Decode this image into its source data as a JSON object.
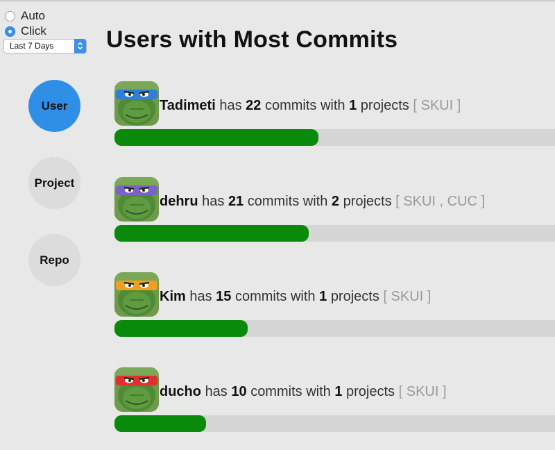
{
  "controls": {
    "mode_options": [
      {
        "label": "Auto",
        "selected": false
      },
      {
        "label": "Click",
        "selected": true
      }
    ],
    "range_select": {
      "value": "Last 7 Days"
    }
  },
  "title": "Users with Most Commits",
  "nav": [
    {
      "label": "User",
      "active": true
    },
    {
      "label": "Project",
      "active": false
    },
    {
      "label": "Repo",
      "active": false
    }
  ],
  "text": {
    "has": "has",
    "commits_with": "commits with",
    "projects": "projects"
  },
  "users": [
    {
      "name": "Tadimeti",
      "commits": "22",
      "project_count": "1",
      "projects_list": "[ SKUI ]",
      "bandana_color": "#2f7fd8",
      "progress": 0.463
    },
    {
      "name": "dehru",
      "commits": "21",
      "project_count": "2",
      "projects_list": "[ SKUI , CUC ]",
      "bandana_color": "#7a62c8",
      "progress": 0.441
    },
    {
      "name": "Kim",
      "commits": "15",
      "project_count": "1",
      "projects_list": "[ SKUI ]",
      "bandana_color": "#f0a020",
      "progress": 0.302
    },
    {
      "name": "ducho",
      "commits": "10",
      "project_count": "1",
      "projects_list": "[ SKUI ]",
      "bandana_color": "#e03030",
      "progress": 0.208
    }
  ],
  "colors": {
    "progress_fill": "#0a8a0a",
    "progress_track": "#d6d6d6",
    "nav_active": "#2f8fe6",
    "nav_inactive": "#dcdcdc"
  }
}
